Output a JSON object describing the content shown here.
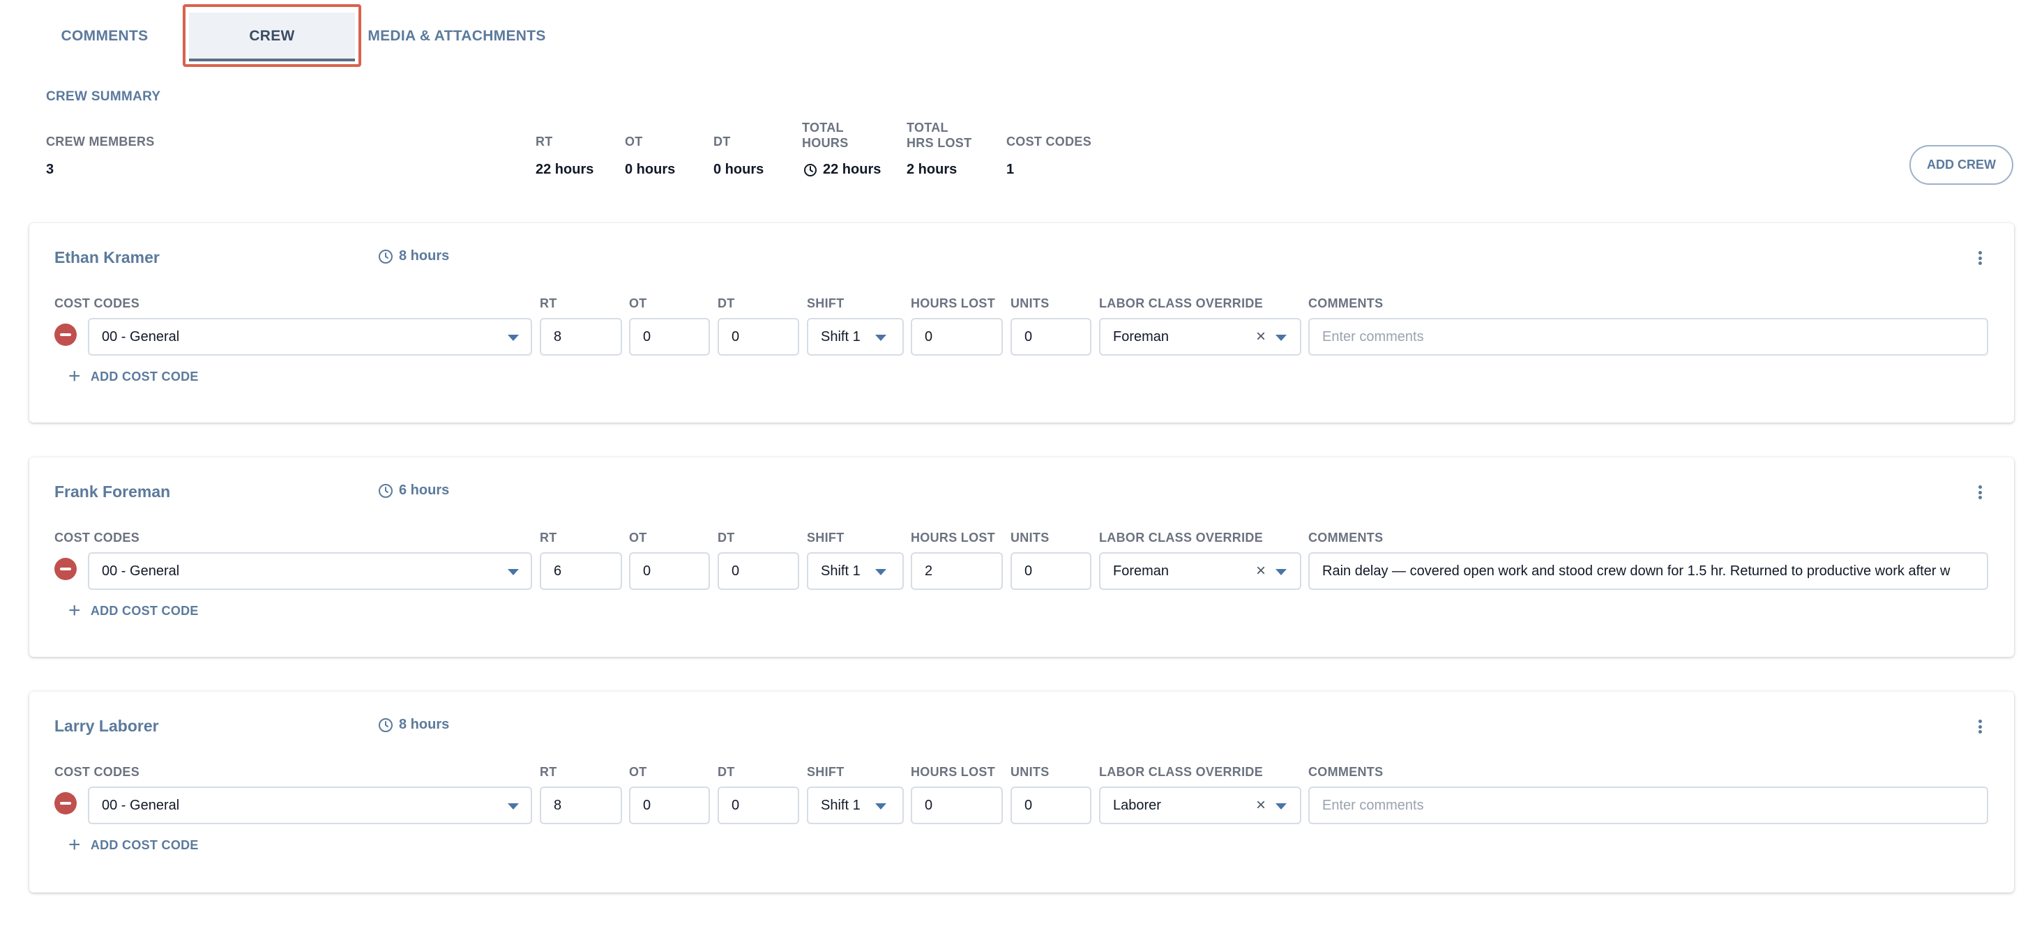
{
  "tabs": [
    {
      "label": "COMMENTS",
      "active": false
    },
    {
      "label": "CREW",
      "active": true
    },
    {
      "label": "MEDIA & ATTACHMENTS",
      "active": false
    }
  ],
  "summary": {
    "title": "CREW SUMMARY",
    "crew_members_label": "CREW MEMBERS",
    "crew_members_value": "3",
    "rt_label": "RT",
    "rt_value": "22 hours",
    "ot_label": "OT",
    "ot_value": "0 hours",
    "dt_label": "DT",
    "dt_value": "0 hours",
    "total_hours_label_1": "TOTAL",
    "total_hours_label_2": "HOURS",
    "total_hours_value": "22 hours",
    "total_hrs_lost_label_1": "TOTAL",
    "total_hrs_lost_label_2": "HRS LOST",
    "total_hrs_lost_value": "2 hours",
    "cost_codes_label": "COST CODES",
    "cost_codes_value": "1",
    "add_crew_label": "ADD CREW"
  },
  "column_labels": {
    "cost_codes": "COST CODES",
    "rt": "RT",
    "ot": "OT",
    "dt": "DT",
    "shift": "SHIFT",
    "hours_lost": "HOURS LOST",
    "units": "UNITS",
    "labor_class": "LABOR CLASS OVERRIDE",
    "comments": "COMMENTS",
    "add_cost_code": "ADD COST CODE",
    "comments_placeholder": "Enter comments"
  },
  "crew": [
    {
      "name": "Ethan Kramer",
      "hours": "8 hours",
      "cost_code": "00 - General",
      "rt": "8",
      "ot": "0",
      "dt": "0",
      "shift": "Shift 1",
      "hours_lost": "0",
      "units": "0",
      "labor_class": "Foreman",
      "comments": ""
    },
    {
      "name": "Frank Foreman",
      "hours": "6 hours",
      "cost_code": "00 - General",
      "rt": "6",
      "ot": "0",
      "dt": "0",
      "shift": "Shift 1",
      "hours_lost": "2",
      "units": "0",
      "labor_class": "Foreman",
      "comments": "Rain delay — covered open work and stood crew down for 1.5 hr. Returned to productive work after w"
    },
    {
      "name": "Larry Laborer",
      "hours": "8 hours",
      "cost_code": "00 - General",
      "rt": "8",
      "ot": "0",
      "dt": "0",
      "shift": "Shift 1",
      "hours_lost": "0",
      "units": "0",
      "labor_class": "Laborer",
      "comments": ""
    }
  ],
  "colors": {
    "accent": "#5b7a9c",
    "tab_highlight": "#d9634d",
    "remove": "#c0504d"
  }
}
